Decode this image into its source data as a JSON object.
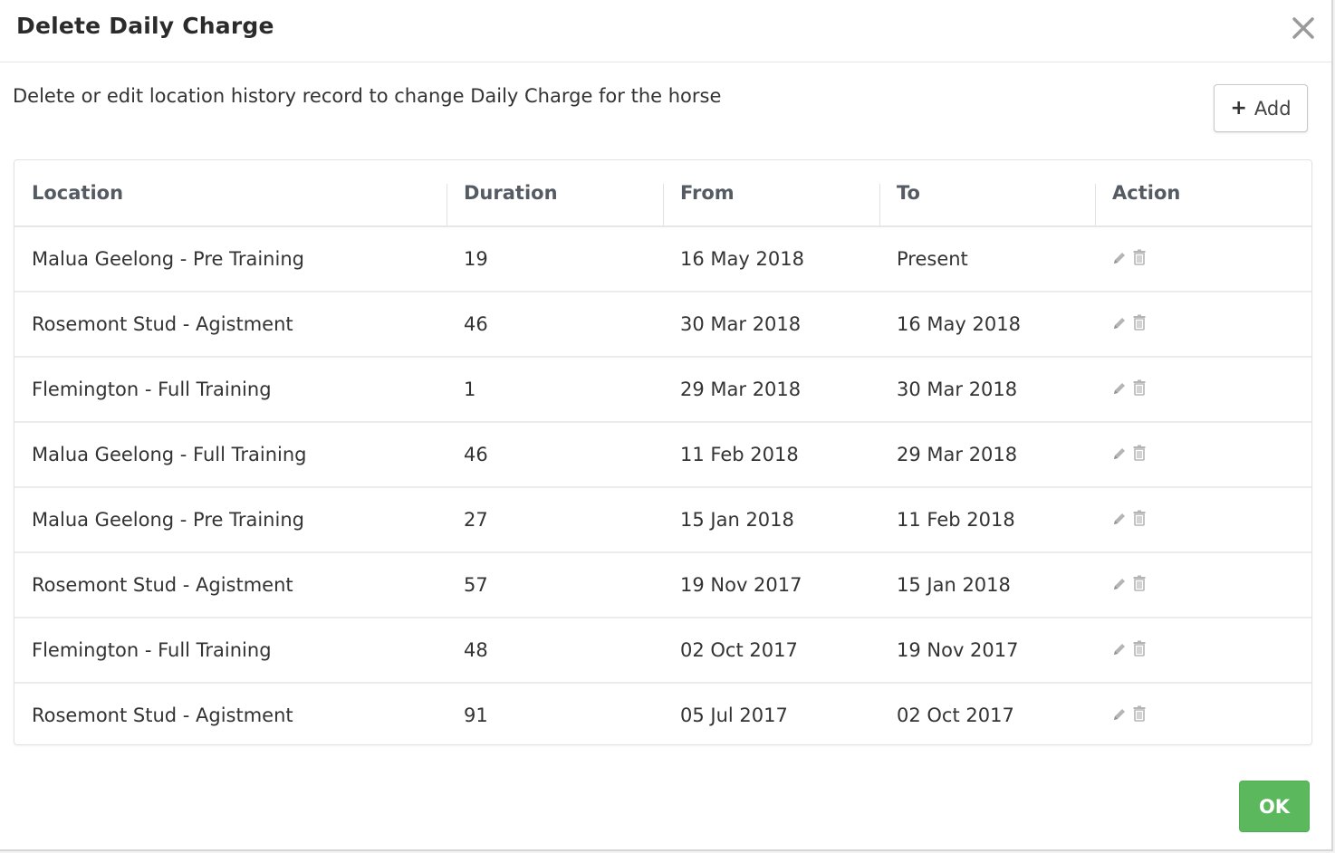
{
  "modal": {
    "title": "Delete Daily Charge",
    "description": "Delete or edit location history record to change Daily Charge for the horse",
    "add_label": "Add",
    "ok_label": "OK"
  },
  "table": {
    "headers": [
      "Location",
      "Duration",
      "From",
      "To",
      "Action"
    ],
    "rows": [
      {
        "location": "Malua Geelong - Pre Training",
        "duration": "19",
        "from": "16 May 2018",
        "to": "Present"
      },
      {
        "location": "Rosemont Stud - Agistment",
        "duration": "46",
        "from": "30 Mar 2018",
        "to": "16 May 2018"
      },
      {
        "location": "Flemington - Full Training",
        "duration": "1",
        "from": "29 Mar 2018",
        "to": "30 Mar 2018"
      },
      {
        "location": "Malua Geelong - Full Training",
        "duration": "46",
        "from": "11 Feb 2018",
        "to": "29 Mar 2018"
      },
      {
        "location": "Malua Geelong - Pre Training",
        "duration": "27",
        "from": "15 Jan 2018",
        "to": "11 Feb 2018"
      },
      {
        "location": "Rosemont Stud - Agistment",
        "duration": "57",
        "from": "19 Nov 2017",
        "to": "15 Jan 2018"
      },
      {
        "location": "Flemington - Full Training",
        "duration": "48",
        "from": "02 Oct 2017",
        "to": "19 Nov 2017"
      },
      {
        "location": "Rosemont Stud - Agistment",
        "duration": "91",
        "from": "05 Jul 2017",
        "to": "02 Oct 2017"
      }
    ],
    "row_icons": [
      "pencil-icon",
      "trash-icon"
    ]
  },
  "colors": {
    "ok_button": "#5cb85c",
    "header_text": "#555b63",
    "body_text": "#333333",
    "icon_gray": "#b5b5b5"
  }
}
